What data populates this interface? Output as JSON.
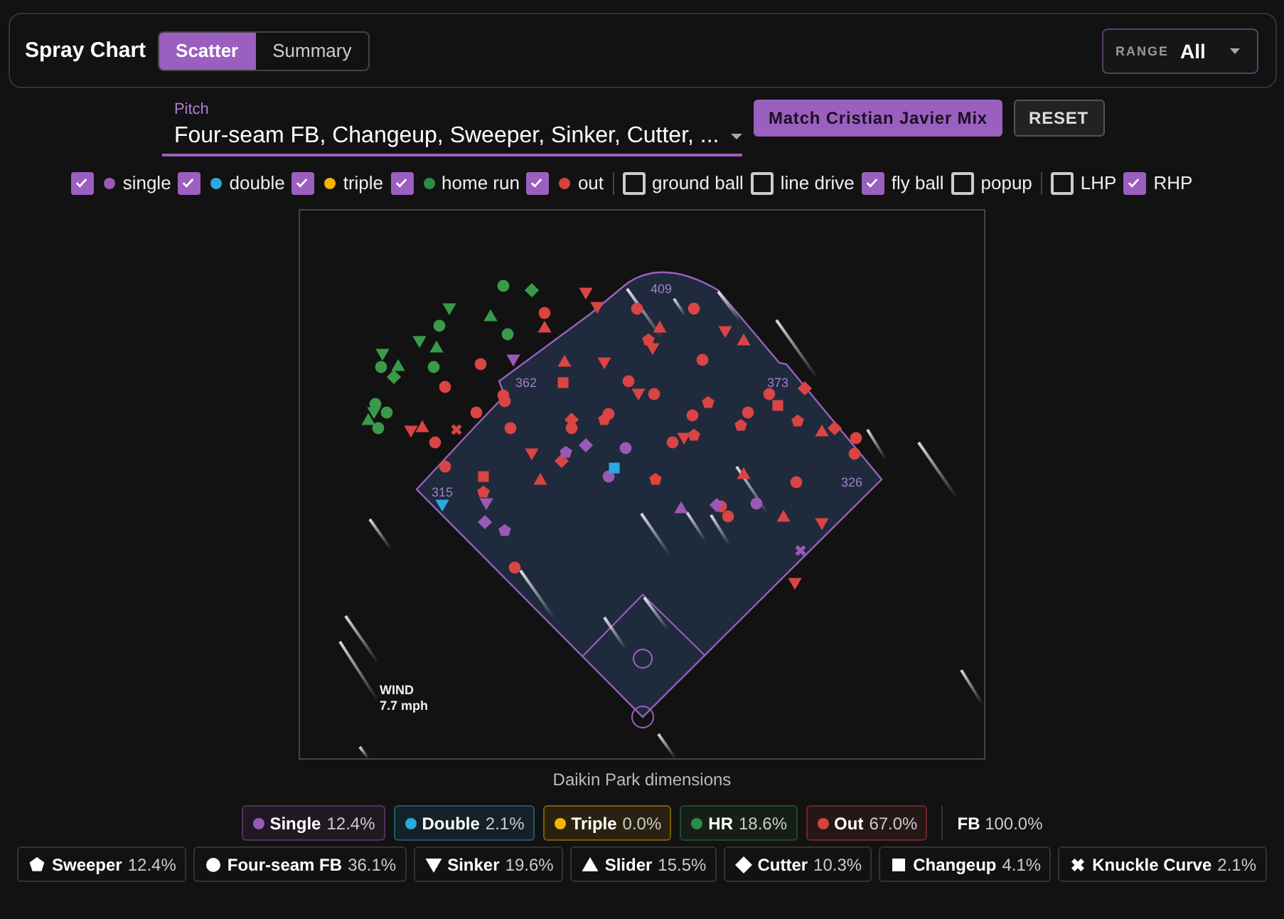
{
  "header": {
    "title": "Spray Chart",
    "tabs": [
      {
        "label": "Scatter",
        "selected": true
      },
      {
        "label": "Summary",
        "selected": false
      }
    ],
    "range": {
      "label": "RANGE",
      "value": "All"
    }
  },
  "pitch_select": {
    "label": "Pitch",
    "value": "Four-seam FB, Changeup, Sweeper, Sinker, Cutter, ..."
  },
  "buttons": [
    {
      "label": "Match Cristian Javier Mix",
      "kind": "primary"
    },
    {
      "label": "RESET",
      "kind": "secondary"
    }
  ],
  "filter_groups": [
    {
      "items": [
        {
          "label": "single",
          "checked": true,
          "color": "#9b59b6"
        },
        {
          "label": "double",
          "checked": true,
          "color": "#29a9e0"
        },
        {
          "label": "triple",
          "checked": true,
          "color": "#f5b400"
        },
        {
          "label": "home run",
          "checked": true,
          "color": "#2e8b44"
        },
        {
          "label": "out",
          "checked": true,
          "color": "#d94040"
        }
      ]
    },
    {
      "items": [
        {
          "label": "ground ball",
          "checked": false
        },
        {
          "label": "line drive",
          "checked": false
        },
        {
          "label": "fly ball",
          "checked": true
        },
        {
          "label": "popup",
          "checked": false
        }
      ]
    },
    {
      "items": [
        {
          "label": "LHP",
          "checked": false
        },
        {
          "label": "RHP",
          "checked": true
        }
      ]
    }
  ],
  "field": {
    "distances": [
      "409",
      "362",
      "373",
      "326",
      "315"
    ],
    "wind_label": "WIND",
    "wind_speed": "7.7 mph",
    "caption": "Daikin Park dimensions"
  },
  "outcome_chips": [
    {
      "label": "Single",
      "value": "12.4%",
      "color": "#9b59b6"
    },
    {
      "label": "Double",
      "value": "2.1%",
      "color": "#29a9e0"
    },
    {
      "label": "Triple",
      "value": "0.0%",
      "color": "#f5b400"
    },
    {
      "label": "HR",
      "value": "18.6%",
      "color": "#2e8b44"
    },
    {
      "label": "Out",
      "value": "67.0%",
      "color": "#d94040"
    }
  ],
  "fb_total": {
    "label": "FB",
    "value": "100.0%"
  },
  "pitch_chips": [
    {
      "kind": "pentagon",
      "label": "Sweeper",
      "value": "12.4%"
    },
    {
      "kind": "circle",
      "label": "Four-seam FB",
      "value": "36.1%"
    },
    {
      "kind": "tri-down",
      "label": "Sinker",
      "value": "19.6%"
    },
    {
      "kind": "tri-up",
      "label": "Slider",
      "value": "15.5%"
    },
    {
      "kind": "diamond",
      "label": "Cutter",
      "value": "10.3%"
    },
    {
      "kind": "square",
      "label": "Changeup",
      "value": "4.1%"
    },
    {
      "kind": "cross",
      "label": "Knuckle Curve",
      "value": "2.1%"
    }
  ]
}
